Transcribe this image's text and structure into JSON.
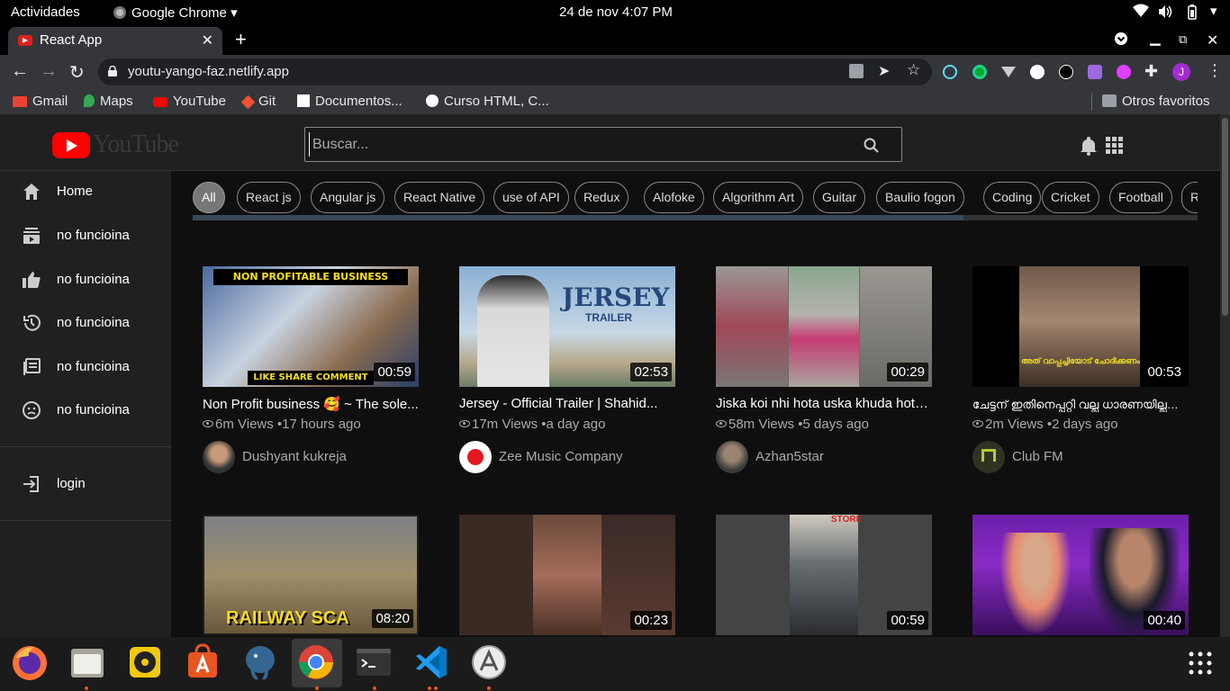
{
  "os": {
    "activities": "Actividades",
    "app_menu": "Google Chrome",
    "clock": "24 de nov  4:07 PM"
  },
  "browser": {
    "tab_title": "React App",
    "url": "youtu-yango-faz.netlify.app",
    "bookmarks": [
      "Gmail",
      "Maps",
      "YouTube",
      "Git",
      "Documentos...",
      "Curso HTML, C..."
    ],
    "other_bookmarks": "Otros favoritos",
    "profile_initial": "J"
  },
  "youtube": {
    "logo_text": "YouTube",
    "search_placeholder": "Buscar...",
    "sidebar": {
      "items": [
        "Home",
        "no funcioina",
        "no funcioina",
        "no funcioina",
        "no funcioina",
        "no funcioina"
      ],
      "login": "login"
    },
    "chips": [
      "All",
      "React js",
      "Angular js",
      "React Native",
      "use of API",
      "Redux",
      "Alofoke",
      "Algorithm Art",
      "Guitar",
      "Baulio fogon",
      "Coding",
      "Cricket",
      "Football",
      "R"
    ],
    "videos": [
      {
        "title": "Non Profit business 🥰 ~ The sole...",
        "views": "6m Views",
        "age": "•17 hours ago",
        "channel": "Dushyant kukreja",
        "duration": "00:59",
        "thumb_banner": "NON PROFITABLE BUSINESS",
        "thumb_footer": "LIKE SHARE COMMENT"
      },
      {
        "title": "Jersey - Official Trailer | Shahid...",
        "views": "17m Views",
        "age": "•a day ago",
        "channel": "Zee Music Company",
        "duration": "02:53",
        "thumb_banner": "JERSEY",
        "thumb_footer": "TRAILER"
      },
      {
        "title": "Jiska koi nhi hota uska khuda hota...",
        "views": "58m Views",
        "age": "•5 days ago",
        "channel": "Azhan5star",
        "duration": "00:29"
      },
      {
        "title": "ചേട്ടന് ഇതിനെപ്പറ്റി വല്ല ധാരണയില്ലല്ലോ...",
        "views": "2m Views",
        "age": "•2 days ago",
        "channel": "Club FM",
        "duration": "00:53",
        "thumb_caption": "അത് വാപ്പച്ചിയോട് ചോദിക്കണം"
      },
      {
        "title": "",
        "duration": "08:20",
        "thumb_caption": "RAILWAY SCA"
      },
      {
        "title": "",
        "duration": "00:23"
      },
      {
        "title": "",
        "duration": "00:59",
        "thumb_caption": "STORE"
      },
      {
        "title": "",
        "duration": "00:40"
      }
    ]
  },
  "colors": {
    "yt_red": "#ff0000",
    "page_bg": "#0f0f0f",
    "header_bg": "#202020",
    "chrome_toolbar": "#35363a",
    "ubuntu_orange": "#e95420"
  }
}
